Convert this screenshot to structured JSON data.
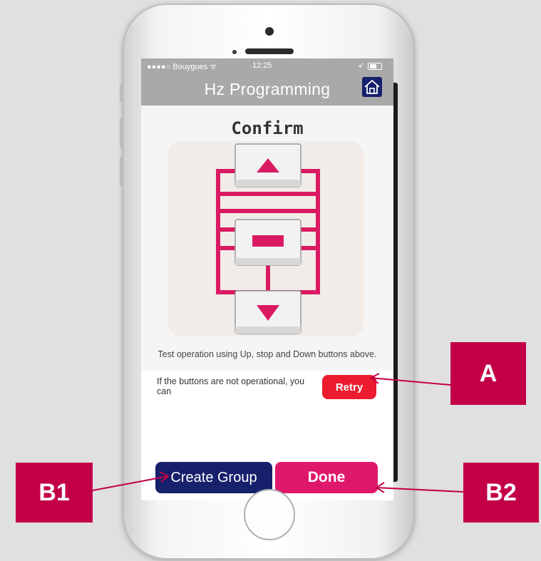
{
  "status_bar": {
    "carrier": "●●●●○ Bouygues ᯤ",
    "time": "12:25",
    "location_glyph": "➶"
  },
  "nav": {
    "title": "Hz Programming",
    "home_icon": "home-icon"
  },
  "content": {
    "heading": "Confirm",
    "instruction": "Test operation using Up, stop and Down buttons above.",
    "not_operational_text": "If the buttons are not operational, you can",
    "retry_label": "Retry"
  },
  "actions": {
    "create_group_label": "Create Group",
    "done_label": "Done"
  },
  "callouts": {
    "a": "A",
    "b1": "B1",
    "b2": "B2"
  },
  "colors": {
    "accent_pink": "#e0186c",
    "navy": "#17206b",
    "retry_red": "#ec1c2e",
    "callout": "#c30047",
    "header_gray": "#a9a9a9"
  }
}
